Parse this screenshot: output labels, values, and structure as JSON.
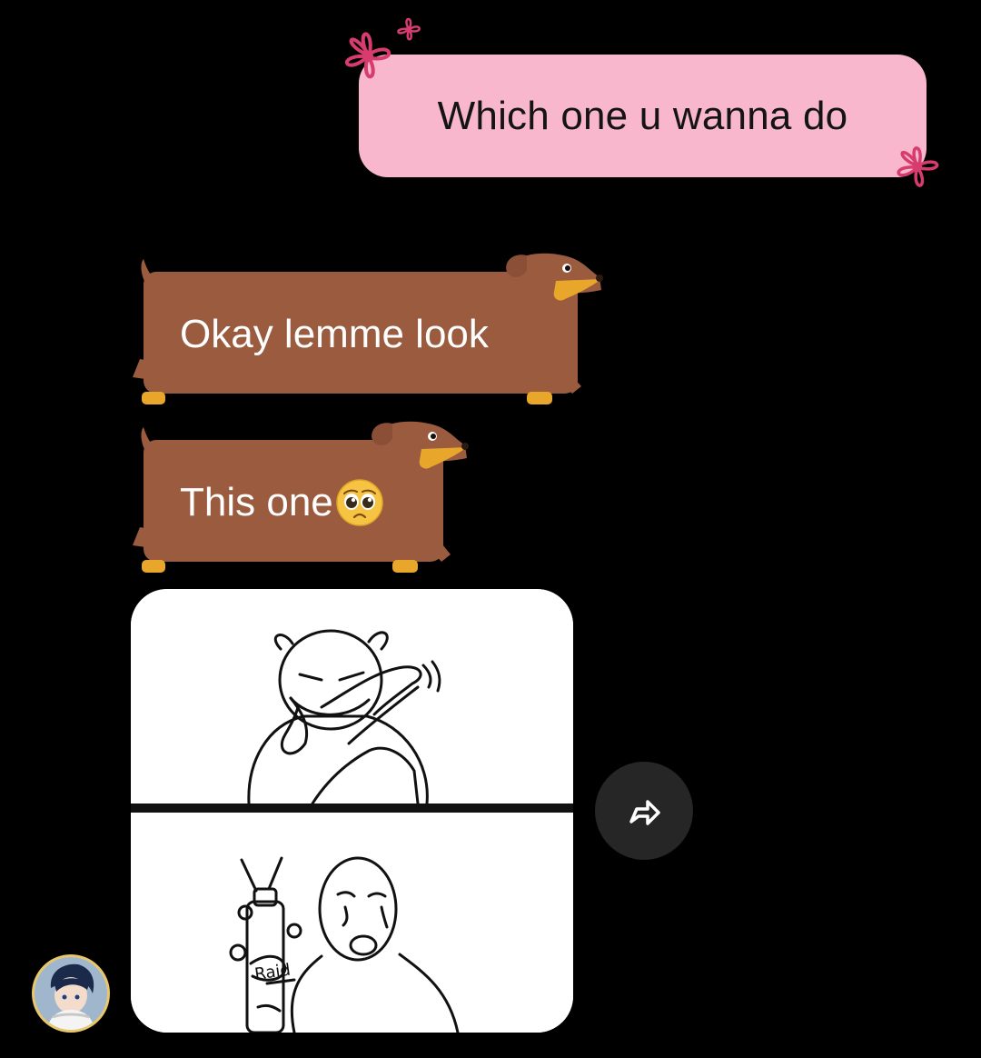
{
  "messages": [
    {
      "from": "me",
      "text": "Which one u wanna do",
      "style": "pink-flowers"
    },
    {
      "from": "them",
      "text": "Okay lemme look",
      "style": "dachshund"
    },
    {
      "from": "them",
      "text": "This one",
      "emoji": "pleading-face",
      "style": "dachshund"
    },
    {
      "from": "them",
      "type": "image",
      "image_text": "Raid",
      "style": "rounded-card"
    }
  ],
  "colors": {
    "background": "#000000",
    "pink_bubble": "#f8b7cc",
    "flower": "#d63d6e",
    "dog_body": "#9a5b3f",
    "dog_paw": "#e8a62a",
    "share_button": "#262626"
  },
  "icons": {
    "share": "share-arrow-icon",
    "avatar": "contact-avatar"
  }
}
